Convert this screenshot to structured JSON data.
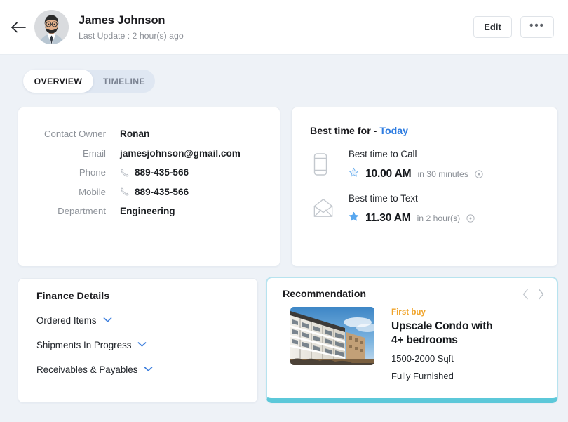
{
  "header": {
    "back_icon": "arrow-left-icon",
    "avatar_alt": "user-avatar",
    "name": "James Johnson",
    "subtitle": "Last Update : 2 hour(s) ago",
    "edit_label": "Edit",
    "more_label": "•••"
  },
  "tabs": [
    {
      "id": "overview",
      "label": "OVERVIEW",
      "active": true
    },
    {
      "id": "timeline",
      "label": "TIMELINE",
      "active": false
    }
  ],
  "contact": {
    "rows": [
      {
        "label": "Contact Owner",
        "value": "Ronan",
        "icon": ""
      },
      {
        "label": "Email",
        "value": "jamesjohnson@gmail.com",
        "icon": ""
      },
      {
        "label": "Phone",
        "value": "889-435-566",
        "icon": "phone-icon"
      },
      {
        "label": "Mobile",
        "value": "889-435-566",
        "icon": "phone-icon"
      },
      {
        "label": "Department",
        "value": "Engineering",
        "icon": ""
      }
    ]
  },
  "best_time": {
    "title_prefix": "Best time for - ",
    "title_link": "Today",
    "items": [
      {
        "icon": "mobile-phone-icon",
        "label": "Best time to Call",
        "star": "star-outline-icon",
        "time": "10.00 AM",
        "relative": "in 30 minutes",
        "info_icon": "clock-info-icon"
      },
      {
        "icon": "envelope-icon",
        "label": "Best time to Text",
        "star": "star-filled-icon",
        "time": "11.30 AM",
        "relative": "in 2 hour(s)",
        "info_icon": "clock-info-icon"
      }
    ]
  },
  "finance": {
    "title": "Finance Details",
    "rows": [
      {
        "label": "Ordered Items",
        "icon": "chevron-down-icon"
      },
      {
        "label": "Shipments In Progress",
        "icon": "chevron-down-icon"
      },
      {
        "label": "Receivables & Payables",
        "icon": "chevron-down-icon"
      }
    ]
  },
  "recommendation": {
    "title": "Recommendation",
    "prev_icon": "chevron-left-icon",
    "next_icon": "chevron-right-icon",
    "thumbnail_alt": "apartment-building-photo",
    "tag": "First buy",
    "name_line1": "Upscale Condo with",
    "name_line2": "4+ bedrooms",
    "size": "1500-2000 Sqft",
    "furnishing": "Fully Furnished"
  },
  "colors": {
    "page_background": "#eef2f7",
    "card_background": "#ffffff",
    "accent_blue": "#2f7de1",
    "accent_teal": "#5cc8d9",
    "tag_orange": "#f0a42a",
    "muted_text": "#8d9299"
  }
}
